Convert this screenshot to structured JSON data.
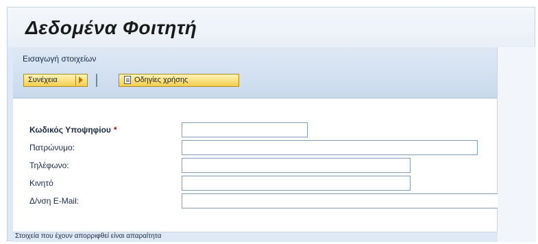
{
  "header": {
    "title": "Δεδομένα Φοιτητή"
  },
  "toolbar": {
    "subtitle": "Εισαγωγή στοιχείων",
    "continue_label": "Συνέχεια",
    "guide_label": "Οδηγίες χρήσης",
    "continue_icon": "arrow-right-icon",
    "guide_icon": "document-icon"
  },
  "form": {
    "fields": [
      {
        "label": "Κωδικός Υποψηφίου",
        "required": true,
        "value": ""
      },
      {
        "label": "Πατρώνυμο:",
        "required": false,
        "value": ""
      },
      {
        "label": "Τηλέφωνο:",
        "required": false,
        "value": ""
      },
      {
        "label": "Κινητό",
        "required": false,
        "value": ""
      },
      {
        "label": "Δ/νση E-Mail:",
        "required": false,
        "value": ""
      }
    ],
    "required_marker": "*"
  },
  "status": {
    "text": "Στοιχεία που έχουν απορριφθεί είναι απαραίτητα"
  },
  "colors": {
    "accent_button": "#f3cf4e",
    "required": "#d00000",
    "panel": "#dfe9f5"
  }
}
